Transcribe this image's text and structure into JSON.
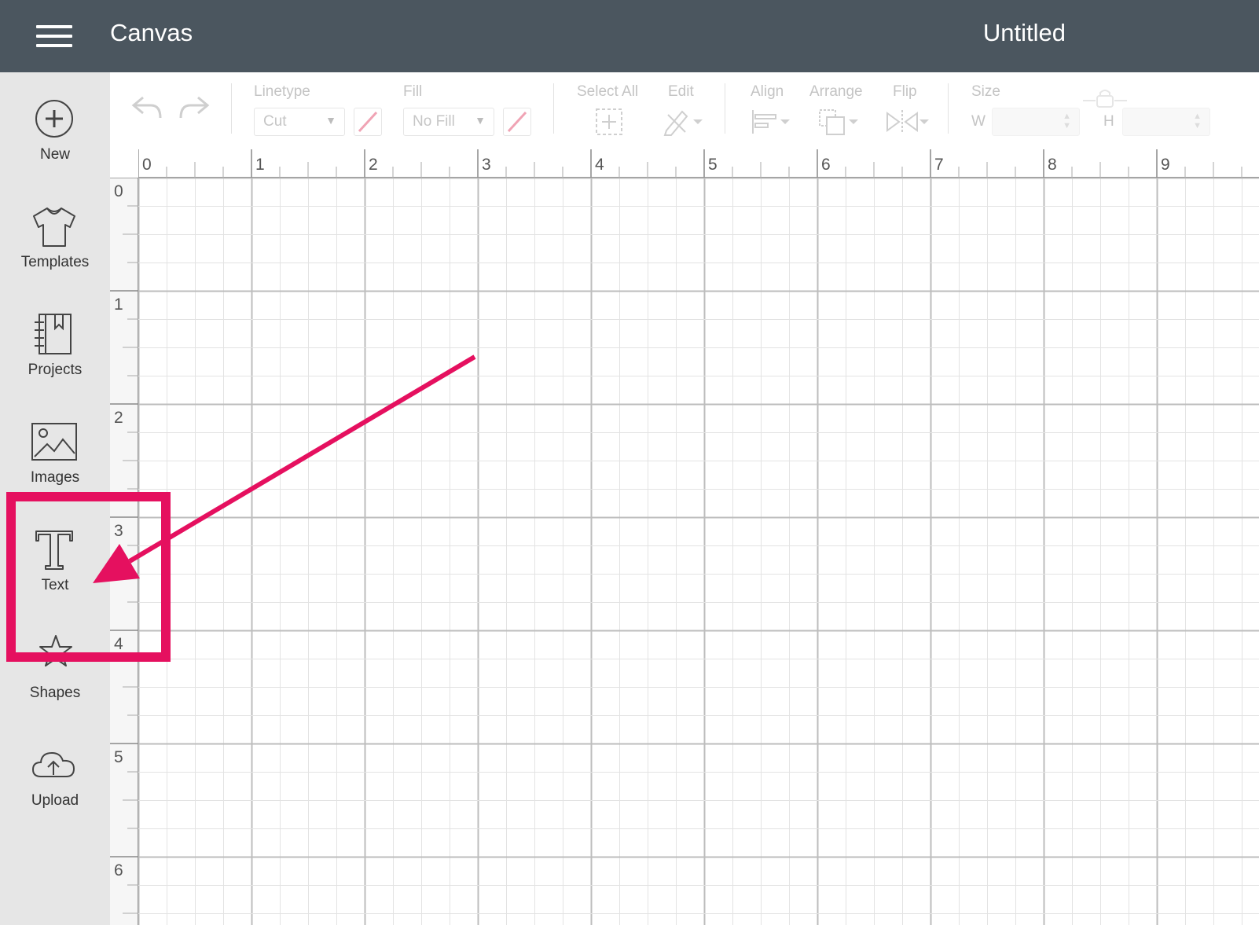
{
  "header": {
    "app_title": "Canvas",
    "document_title": "Untitled"
  },
  "sidebar": {
    "items": [
      {
        "label": "New",
        "icon": "plus-circle-icon"
      },
      {
        "label": "Templates",
        "icon": "tshirt-icon"
      },
      {
        "label": "Projects",
        "icon": "notebook-icon"
      },
      {
        "label": "Images",
        "icon": "image-icon"
      },
      {
        "label": "Text",
        "icon": "text-t-icon"
      },
      {
        "label": "Shapes",
        "icon": "shapes-icon"
      },
      {
        "label": "Upload",
        "icon": "cloud-upload-icon"
      }
    ]
  },
  "toolbar": {
    "linetype_label": "Linetype",
    "linetype_value": "Cut",
    "fill_label": "Fill",
    "fill_value": "No Fill",
    "select_all_label": "Select All",
    "edit_label": "Edit",
    "align_label": "Align",
    "arrange_label": "Arrange",
    "flip_label": "Flip",
    "size_label": "Size",
    "width_label": "W",
    "height_label": "H"
  },
  "ruler": {
    "top": [
      "0",
      "1",
      "2",
      "3",
      "4",
      "5",
      "6",
      "7",
      "8",
      "9"
    ],
    "left": [
      "0",
      "1",
      "2",
      "3",
      "4",
      "5",
      "6"
    ]
  },
  "annotation": {
    "highlight_color": "#e5105f",
    "highlighted_item": "Text"
  },
  "colors": {
    "header_bg": "#4b565f",
    "sidebar_bg": "#e6e6e6",
    "swatch": "#f0a3b4"
  }
}
